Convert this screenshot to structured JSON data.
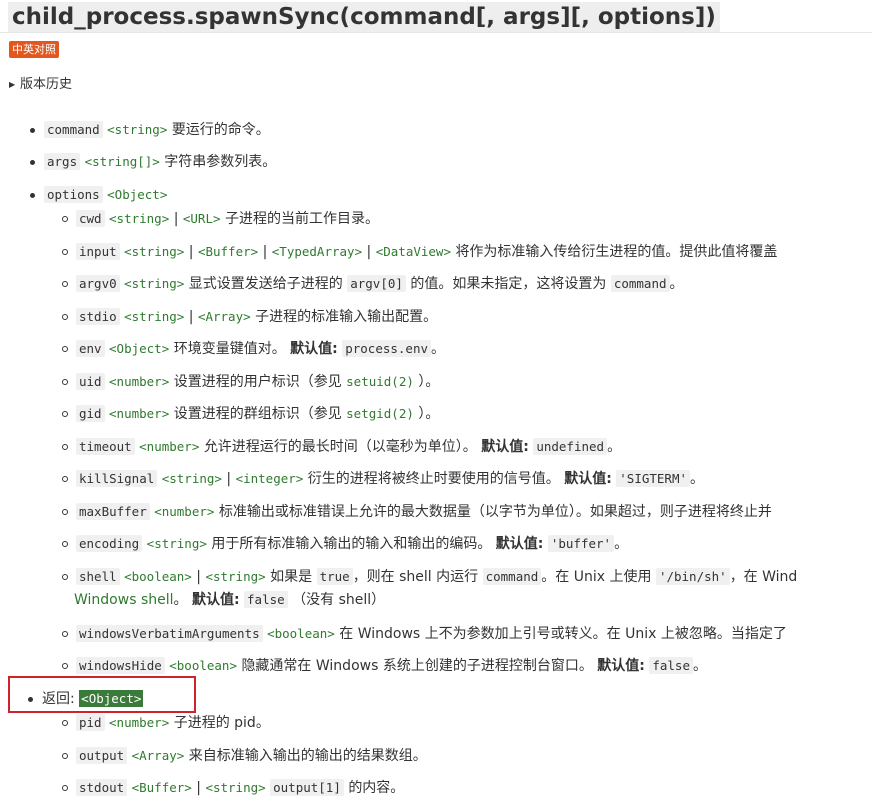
{
  "title": "child_process.spawnSync(command[, args][, options])",
  "badge": "中英对照",
  "history": "版本历史",
  "items": {
    "command": {
      "name": "command",
      "type": "<string>",
      "desc": "要运行的命令。"
    },
    "args": {
      "name": "args",
      "type": "<string[]>",
      "desc": "字符串参数列表。"
    },
    "options": {
      "name": "options",
      "type": "<Object>"
    },
    "returns": {
      "label": "返回:",
      "type": "<Object>"
    }
  },
  "options": {
    "cwd": {
      "name": "cwd",
      "type1": "<string>",
      "sep": "|",
      "type2": "<URL>",
      "desc": "子进程的当前工作目录。"
    },
    "input": {
      "name": "input",
      "type1": "<string>",
      "type2": "<Buffer>",
      "type3": "<TypedArray>",
      "type4": "<DataView>",
      "sep": "|",
      "desc": "将作为标准输入传给衍生进程的值。提供此值将覆盖"
    },
    "argv0": {
      "name": "argv0",
      "type": "<string>",
      "desc1": "显式设置发送给子进程的",
      "code1": "argv[0]",
      "desc2": "的值。如果未指定，这将设置为",
      "code2": "command",
      "desc3": "。"
    },
    "stdio": {
      "name": "stdio",
      "type1": "<string>",
      "sep": "|",
      "type2": "<Array>",
      "desc": "子进程的标准输入输出配置。"
    },
    "env": {
      "name": "env",
      "type": "<Object>",
      "desc": "环境变量键值对。",
      "default_label": "默认值:",
      "default_value": "process.env",
      "end": "。"
    },
    "uid": {
      "name": "uid",
      "type": "<number>",
      "desc1": "设置进程的用户标识（参见",
      "link": "setuid(2)",
      "desc2": "）。"
    },
    "gid": {
      "name": "gid",
      "type": "<number>",
      "desc1": "设置进程的群组标识（参见",
      "link": "setgid(2)",
      "desc2": "）。"
    },
    "timeout": {
      "name": "timeout",
      "type": "<number>",
      "desc": "允许进程运行的最长时间（以毫秒为单位）。",
      "default_label": "默认值:",
      "default_value": "undefined",
      "end": "。"
    },
    "killSignal": {
      "name": "killSignal",
      "type1": "<string>",
      "sep": "|",
      "type2": "<integer>",
      "desc": "衍生的进程将被终止时要使用的信号值。",
      "default_label": "默认值:",
      "default_value": "'SIGTERM'",
      "end": "。"
    },
    "maxBuffer": {
      "name": "maxBuffer",
      "type": "<number>",
      "desc": "标准输出或标准错误上允许的最大数据量（以字节为单位）。如果超过，则子进程将终止并"
    },
    "encoding": {
      "name": "encoding",
      "type": "<string>",
      "desc": "用于所有标准输入输出的输入和输出的编码。",
      "default_label": "默认值:",
      "default_value": "'buffer'",
      "end": "。"
    },
    "shell": {
      "name": "shell",
      "type1": "<boolean>",
      "sep": "|",
      "type2": "<string>",
      "desc1": "如果是",
      "code1": "true",
      "desc2": "，则在 shell 内运行",
      "code2": "command",
      "desc3": "。在 Unix 上使用",
      "code3": "'/bin/sh'",
      "desc4": "，在 Wind",
      "link2": "Windows shell",
      "desc5": "。",
      "default_label": "默认值:",
      "default_value": "false",
      "desc6": "（没有 shell）"
    },
    "windowsVerbatimArguments": {
      "name": "windowsVerbatimArguments",
      "type": "<boolean>",
      "desc": "在 Windows 上不为参数加上引号或转义。在 Unix 上被忽略。当指定了"
    },
    "windowsHide": {
      "name": "windowsHide",
      "type": "<boolean>",
      "desc": "隐藏通常在 Windows 系统上创建的子进程控制台窗口。",
      "default_label": "默认值:",
      "default_value": "false",
      "end": "。"
    }
  },
  "returns": {
    "pid": {
      "name": "pid",
      "type": "<number>",
      "desc": "子进程的 pid。"
    },
    "output": {
      "name": "output",
      "type": "<Array>",
      "desc": "来自标准输入输出的输出的结果数组。"
    },
    "stdout": {
      "name": "stdout",
      "type1": "<Buffer>",
      "sep": "|",
      "type2": "<string>",
      "code": "output[1]",
      "desc": "的内容。"
    }
  }
}
